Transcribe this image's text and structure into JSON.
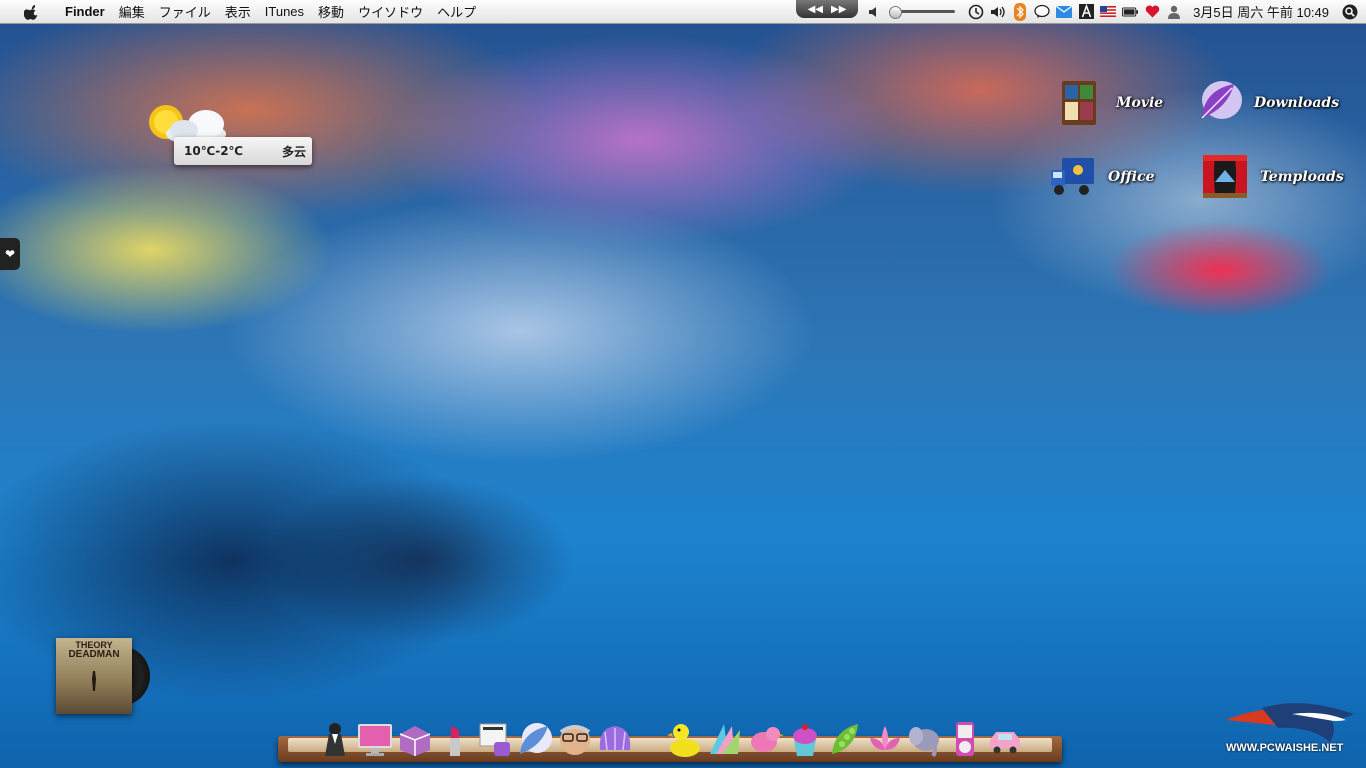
{
  "menubar": {
    "apple_icon": "apple-logo-icon",
    "items": [
      "Finder",
      "編集",
      "ファイル",
      "表示",
      "ITunes",
      "移動",
      "ウイソドウ",
      "ヘルプ"
    ],
    "status_icons": [
      "volume-icon",
      "time-machine-icon",
      "volume-speaker-icon",
      "bluetooth-icon",
      "chat-icon",
      "mail-icon",
      "font-icon",
      "flag-us-icon",
      "battery-icon",
      "heart-icon",
      "user-icon",
      "spotlight-icon"
    ],
    "clock": "3月5日 周六 午前 10:49"
  },
  "weather": {
    "temperature": "10℃-2℃",
    "condition": "多云"
  },
  "desktop_icons": [
    {
      "label": "Movie"
    },
    {
      "label": "Downloads"
    },
    {
      "label": "Office"
    },
    {
      "label": "Temploads"
    }
  ],
  "album": {
    "title_line1": "THEORY",
    "title_line2": "DEADMAN"
  },
  "dock": {
    "items": [
      "butler-icon",
      "monitor-icon",
      "toolbox-icon",
      "lipstick-icon",
      "newspaper-icon",
      "feather-icon",
      "grandpa-icon",
      "shell-icon",
      "duck-icon",
      "wings-icon",
      "bird-icon",
      "cupcake-icon",
      "peapod-icon",
      "lotus-icon",
      "elephant-icon",
      "ipod-icon",
      "car-icon"
    ]
  },
  "watermark": {
    "text": "WWW.PCWAISHE.NET"
  }
}
